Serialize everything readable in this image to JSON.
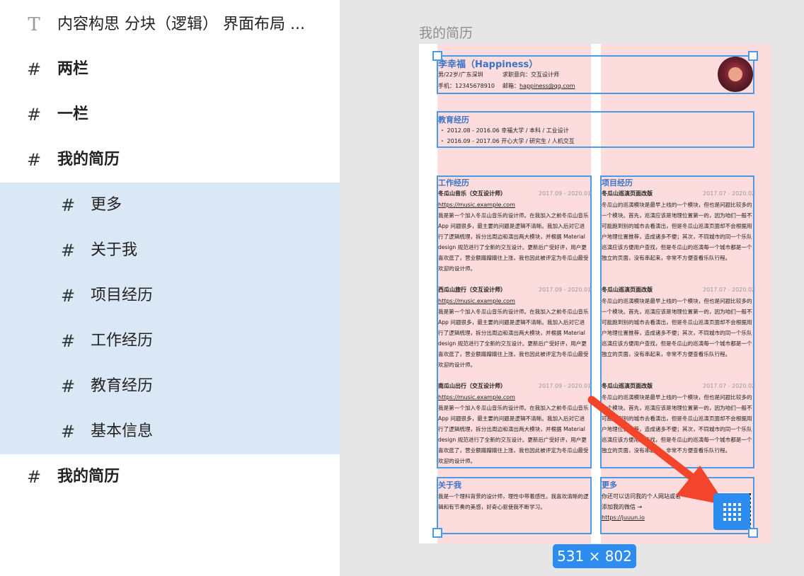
{
  "layers": [
    {
      "icon": "text-icon",
      "glyph": "T",
      "label": "内容构思 分块（逻辑） 界面布局 ..."
    },
    {
      "icon": "frame-icon",
      "glyph": "#",
      "label": "两栏"
    },
    {
      "icon": "frame-icon",
      "glyph": "#",
      "label": "一栏"
    },
    {
      "icon": "frame-icon",
      "glyph": "#",
      "label": "我的简历"
    },
    {
      "icon": "frame-icon",
      "glyph": "#",
      "label": "更多"
    },
    {
      "icon": "frame-icon",
      "glyph": "#",
      "label": "关于我"
    },
    {
      "icon": "frame-icon",
      "glyph": "#",
      "label": "项目经历"
    },
    {
      "icon": "frame-icon",
      "glyph": "#",
      "label": "工作经历"
    },
    {
      "icon": "frame-icon",
      "glyph": "#",
      "label": "教育经历"
    },
    {
      "icon": "frame-icon",
      "glyph": "#",
      "label": "基本信息"
    },
    {
      "icon": "frame-icon",
      "glyph": "#",
      "label": "我的简历"
    }
  ],
  "canvas": {
    "frame_title": "我的简历",
    "dimension_badge": "531 × 802",
    "colors": {
      "selection": "#4a9ae4",
      "column_shade": "#fcdcdc",
      "accent": "#2d8cf0",
      "heading": "#3d73c5"
    }
  },
  "resume": {
    "name": "李幸福（Happiness）",
    "gender_age_city": "男/22岁/广东深圳",
    "intent": "求职意向：交互设计师",
    "phone": "手机：12345678910",
    "email_label": "邮箱：",
    "email": "happiness@qq.com",
    "education": {
      "title": "教育经历",
      "items": [
        "・ 2012.08 - 2016.06  幸福大学 / 本科 / 工业设计",
        "・ 2016.09 - 2017.06  开心大学 / 研究生 / 人机交互"
      ]
    },
    "work": {
      "title": "工作经历",
      "entries": [
        {
          "company": "冬瓜山音乐（交互设计师）",
          "date": "2017.09 - 2020.01",
          "url": "https://music.example.com",
          "desc": "我是第一个加入冬瓜山音乐的设计师。在我加入之前冬瓜山音乐 App 问题很多，最主要的问题是逻辑不清晰。我加入后对它进行了逻辑梳理，拆分出周边和演出两大模块，并根据 Material design 规范进行了全新的交互设计。更新后广受好评，用户更喜欢逛了，营业额蹭蹭蹭往上涨，我也因此被评定为冬瓜山最受欢迎的设计师。"
        },
        {
          "company": "西瓜山旅行（交互设计师）",
          "date": "2017.09 - 2020.01",
          "url": "https://music.example.com",
          "desc": "我是第一个加入冬瓜山音乐的设计师。在我加入之前冬瓜山音乐 App 问题很多，最主要的问题是逻辑不清晰。我加入后对它进行了逻辑梳理，拆分出周边和演出两大模块，并根据 Material design 规范进行了全新的交互设计。更新后广受好评，用户更喜欢逛了，营业额蹭蹭蹭往上涨，我也因此被评定为冬瓜山最受欢迎的设计师。"
        },
        {
          "company": "南瓜山出行（交互设计师）",
          "date": "2017.09 - 2020.01",
          "url": "https://music.example.com",
          "desc": "我是第一个加入冬瓜山音乐的设计师。在我加入之前冬瓜山音乐 App 问题很多，最主要的问题是逻辑不清晰。我加入后对它进行了逻辑梳理，拆分出周边和演出两大模块，并根据 Material design 规范进行了全新的交互设计。更新后广受好评，用户更喜欢逛了，营业额蹭蹭蹭往上涨，我也因此被评定为冬瓜山最受欢迎的设计师。"
        }
      ]
    },
    "projects": {
      "title": "项目经历",
      "entries": [
        {
          "name": "冬瓜山巡演页面改版",
          "date": "2017.07 - 2020.02",
          "desc": "冬瓜山的巡演模块是最早上线的一个模块，但也是问题比较多的一个模块。首先，巡演应该是地理位置第一的，因为咱们一般不可能跑到别的城市去看演出，但是冬瓜山巡演页面却不会根据用户地理位置推荐，造成诸多不便；其次，不同城市的同一个乐队巡演应该方便用户查找，但是冬瓜山的巡演每一个城市都是一个独立的页面，没有串起来，非常不方便查看乐队行程。"
        },
        {
          "name": "冬瓜山巡演页面改版",
          "date": "2017.07 - 2020.02",
          "desc": "冬瓜山的巡演模块是最早上线的一个模块，但也是问题比较多的一个模块。首先，巡演应该是地理位置第一的，因为咱们一般不可能跑到别的城市去看演出，但是冬瓜山巡演页面却不会根据用户地理位置推荐，造成诸多不便；其次，不同城市的同一个乐队巡演应该方便用户查找，但是冬瓜山的巡演每一个城市都是一个独立的页面，没有串起来，非常不方便查看乐队行程。"
        },
        {
          "name": "冬瓜山巡演页面改版",
          "date": "2017.07 - 2020.02",
          "desc": "冬瓜山的巡演模块是最早上线的一个模块，但也是问题比较多的一个模块。首先，巡演应该是地理位置第一的，因为咱们一般不可能跑到别的城市去看演出，但是冬瓜山巡演页面却不会根据用户地理位置推荐，造成诸多不便；其次，不同城市的同一个乐队巡演应该方便用户查找，但是冬瓜山的巡演每一个城市都是一个独立的页面，没有串起来，非常不方便查看乐队行程。"
        }
      ]
    },
    "about": {
      "title": "关于我",
      "desc": "我是一个理科背景的设计师，理性中带着感性。我喜欢清晰的逻辑和有节奏的美感，好奇心驱使我不断学习。"
    },
    "more": {
      "title": "更多",
      "line1": "你还可以访问我的个人网站或者",
      "line2": "添加我的微信 →",
      "url": "https://juuun.io"
    }
  }
}
